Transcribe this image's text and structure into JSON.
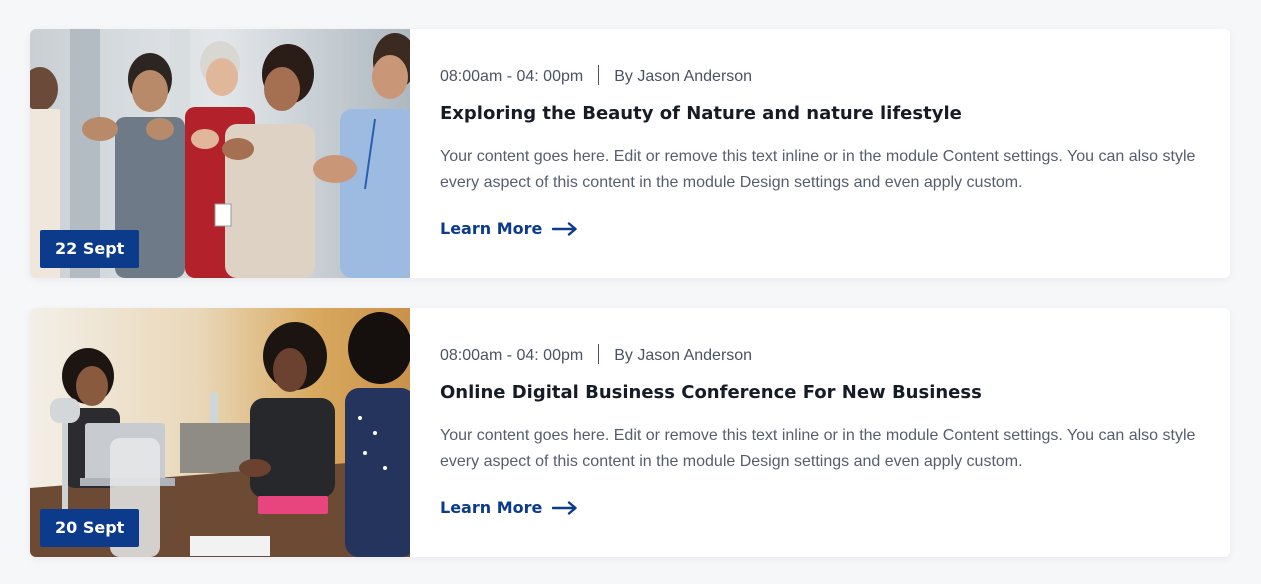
{
  "events": [
    {
      "date": "22 Sept",
      "time": "08:00am - 04: 00pm",
      "author": "By Jason Anderson",
      "title": "Exploring the Beauty of Nature and nature lifestyle",
      "description": "Your content goes here. Edit or remove this text inline or in the module Content settings. You can also style every aspect of this content in the module Design settings and even apply custom.",
      "link_label": "Learn More",
      "image": "conference-audience-applauding-photo"
    },
    {
      "date": "20 Sept",
      "time": "08:00am - 04: 00pm",
      "author": "By Jason Anderson",
      "title": "Online Digital Business Conference For New Business",
      "description": "Your content goes here. Edit or remove this text inline or in the module Content settings. You can also style every aspect of this content in the module Design settings and even apply custom.",
      "link_label": "Learn More",
      "image": "business-meeting-table-photo"
    }
  ],
  "colors": {
    "accent": "#0c3b8c",
    "page_background": "#f6f7f9",
    "card_background": "#ffffff",
    "title_text": "#161b26",
    "body_text": "#565d6d"
  },
  "icons": {
    "link_arrow": "arrow-right-icon"
  }
}
